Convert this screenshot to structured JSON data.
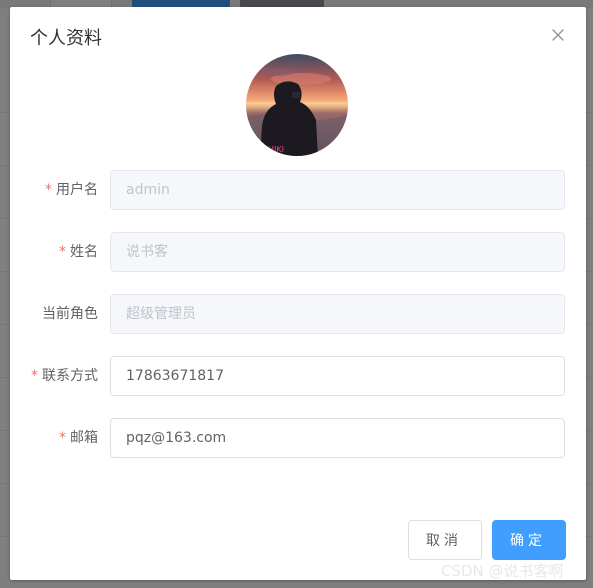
{
  "dialog": {
    "title": "个人资料",
    "close_icon": "close-icon"
  },
  "avatar": {
    "icon": "avatar-photo"
  },
  "form": {
    "username": {
      "label": "用户名",
      "required": true,
      "value": "admin",
      "disabled": true
    },
    "name": {
      "label": "姓名",
      "required": true,
      "value": "说书客",
      "disabled": true
    },
    "role": {
      "label": "当前角色",
      "required": false,
      "value": "超级管理员",
      "disabled": true
    },
    "phone": {
      "label": "联系方式",
      "required": true,
      "value": "17863671817",
      "disabled": false
    },
    "email": {
      "label": "邮箱",
      "required": true,
      "value": "pqz@163.com",
      "disabled": false
    }
  },
  "footer": {
    "cancel_label": "取消",
    "ok_label": "确定"
  },
  "watermark": "CSDN @说书客啊",
  "colors": {
    "primary": "#409eff",
    "required": "#f56c6c",
    "disabled_bg": "#f5f7fa"
  }
}
